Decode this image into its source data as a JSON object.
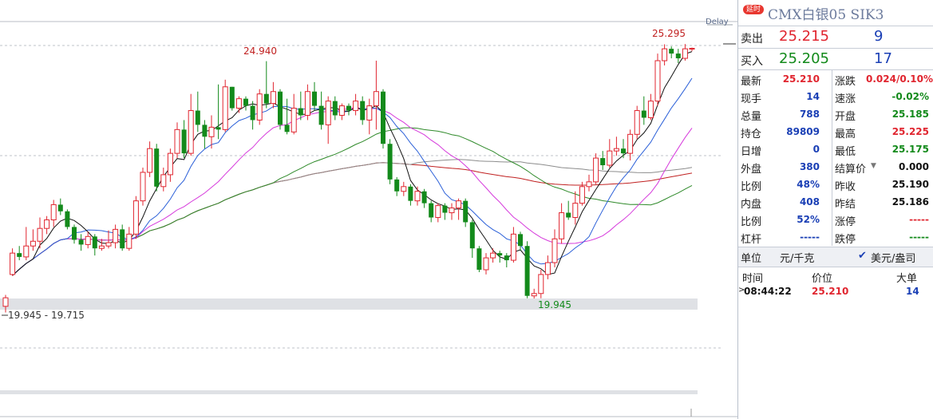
{
  "colors": {
    "up": "#e0252f",
    "down": "#138a1b",
    "ma5": "#111111",
    "ma10": "#2a5fd8",
    "ma20": "#d63adc",
    "ma40": "#2f8a2a",
    "ma60": "#8c8c8c",
    "ma120": "#c02020",
    "price_blue": "#1a3fb5"
  },
  "chart": {
    "delay_label": "Delay",
    "range_label": "19.945 - 19.715",
    "high_label": "24.940",
    "low_label": "19.945",
    "last_high_label": "25.295"
  },
  "chart_data": {
    "type": "candlestick",
    "ylim": [
      19.4,
      25.6
    ],
    "high_annotations": [
      24.94,
      25.295
    ],
    "low_annotation": 19.945,
    "candles": [
      [
        19.78,
        19.96,
        19.65,
        20.02
      ],
      [
        20.45,
        20.9,
        20.42,
        21.0
      ],
      [
        20.9,
        20.82,
        20.75,
        21.05
      ],
      [
        20.82,
        21.05,
        20.75,
        21.45
      ],
      [
        21.05,
        21.15,
        20.95,
        21.4
      ],
      [
        21.15,
        21.42,
        21.0,
        21.65
      ],
      [
        21.42,
        21.6,
        21.3,
        21.68
      ],
      [
        21.6,
        21.92,
        21.45,
        22.02
      ],
      [
        21.92,
        21.78,
        21.7,
        22.05
      ],
      [
        21.78,
        21.45,
        21.4,
        21.82
      ],
      [
        21.45,
        21.18,
        21.1,
        21.5
      ],
      [
        21.18,
        21.08,
        20.95,
        21.3
      ],
      [
        21.08,
        21.25,
        21.0,
        21.35
      ],
      [
        21.25,
        21.0,
        20.85,
        21.3
      ],
      [
        21.0,
        21.05,
        20.95,
        21.2
      ],
      [
        21.05,
        21.12,
        21.0,
        21.38
      ],
      [
        21.12,
        21.4,
        21.0,
        21.5
      ],
      [
        21.4,
        21.0,
        20.95,
        21.5
      ],
      [
        21.0,
        21.3,
        20.95,
        21.45
      ],
      [
        21.3,
        22.0,
        21.2,
        22.1
      ],
      [
        22.0,
        22.6,
        21.9,
        22.7
      ],
      [
        22.6,
        23.1,
        22.5,
        23.25
      ],
      [
        23.1,
        22.3,
        22.2,
        23.2
      ],
      [
        22.3,
        22.55,
        22.2,
        22.7
      ],
      [
        22.55,
        23.0,
        22.4,
        23.1
      ],
      [
        23.0,
        23.5,
        22.9,
        23.65
      ],
      [
        23.5,
        23.0,
        22.9,
        23.7
      ],
      [
        23.0,
        23.9,
        22.95,
        24.25
      ],
      [
        23.9,
        23.6,
        23.45,
        24.3
      ],
      [
        23.6,
        23.35,
        23.1,
        23.7
      ],
      [
        23.35,
        23.55,
        23.1,
        23.8
      ],
      [
        23.55,
        23.5,
        23.3,
        24.45
      ],
      [
        23.5,
        24.4,
        23.45,
        24.55
      ],
      [
        24.4,
        23.95,
        23.9,
        24.4
      ],
      [
        23.95,
        24.15,
        23.85,
        24.2
      ],
      [
        24.15,
        24.0,
        23.9,
        24.2
      ],
      [
        24.0,
        23.7,
        23.5,
        24.1
      ],
      [
        23.7,
        24.25,
        23.6,
        24.35
      ],
      [
        24.25,
        24.05,
        23.95,
        24.94
      ],
      [
        24.05,
        24.3,
        23.95,
        24.5
      ],
      [
        24.3,
        23.6,
        23.5,
        24.35
      ],
      [
        23.6,
        23.45,
        23.4,
        24.15
      ],
      [
        23.45,
        23.95,
        23.4,
        24.25
      ],
      [
        23.95,
        23.8,
        23.7,
        24.3
      ],
      [
        23.8,
        24.3,
        23.7,
        24.45
      ],
      [
        24.3,
        24.0,
        23.9,
        24.5
      ],
      [
        24.0,
        23.6,
        23.5,
        24.3
      ],
      [
        23.6,
        24.1,
        23.2,
        24.2
      ],
      [
        24.1,
        23.8,
        23.7,
        24.2
      ],
      [
        23.8,
        24.0,
        23.7,
        24.05
      ],
      [
        24.0,
        23.9,
        23.8,
        24.05
      ],
      [
        23.9,
        24.1,
        23.8,
        24.25
      ],
      [
        24.1,
        23.7,
        23.6,
        24.2
      ],
      [
        23.7,
        24.0,
        23.4,
        24.15
      ],
      [
        24.0,
        24.3,
        23.5,
        24.95
      ],
      [
        24.3,
        23.2,
        23.1,
        24.35
      ],
      [
        23.2,
        22.45,
        22.35,
        23.3
      ],
      [
        22.45,
        22.2,
        22.1,
        22.5
      ],
      [
        22.2,
        22.3,
        22.1,
        22.4
      ],
      [
        22.3,
        22.0,
        21.9,
        22.35
      ],
      [
        22.0,
        22.2,
        21.9,
        22.3
      ],
      [
        22.2,
        21.95,
        21.85,
        22.25
      ],
      [
        21.95,
        21.65,
        21.55,
        22.0
      ],
      [
        21.65,
        21.9,
        21.55,
        21.95
      ],
      [
        21.9,
        21.75,
        21.6,
        21.95
      ],
      [
        21.75,
        21.85,
        21.6,
        21.95
      ],
      [
        21.85,
        22.0,
        21.6,
        22.05
      ],
      [
        22.0,
        21.55,
        21.45,
        22.05
      ],
      [
        21.55,
        21.0,
        20.8,
        21.6
      ],
      [
        21.0,
        20.55,
        20.5,
        21.05
      ],
      [
        20.55,
        20.8,
        20.45,
        20.9
      ],
      [
        20.8,
        20.9,
        20.7,
        21.0
      ],
      [
        20.9,
        20.85,
        20.7,
        20.95
      ],
      [
        20.85,
        20.75,
        20.6,
        20.9
      ],
      [
        20.75,
        21.3,
        20.7,
        21.45
      ],
      [
        21.3,
        21.05,
        20.95,
        21.35
      ],
      [
        21.05,
        20.0,
        19.95,
        21.15
      ],
      [
        20.0,
        20.05,
        19.945,
        20.15
      ],
      [
        20.05,
        20.45,
        19.95,
        20.55
      ],
      [
        20.45,
        20.7,
        20.35,
        20.85
      ],
      [
        20.7,
        21.2,
        20.6,
        21.4
      ],
      [
        21.2,
        21.75,
        21.1,
        21.95
      ],
      [
        21.75,
        21.65,
        21.6,
        22.0
      ],
      [
        21.65,
        21.95,
        21.5,
        22.2
      ],
      [
        21.95,
        22.3,
        21.9,
        22.4
      ],
      [
        22.3,
        22.4,
        22.2,
        22.55
      ],
      [
        22.4,
        22.9,
        22.35,
        23.0
      ],
      [
        22.9,
        22.75,
        22.65,
        23.05
      ],
      [
        22.75,
        23.05,
        22.7,
        23.3
      ],
      [
        23.05,
        23.1,
        22.95,
        23.35
      ],
      [
        23.1,
        23.0,
        22.9,
        23.3
      ],
      [
        23.0,
        23.4,
        22.85,
        23.5
      ],
      [
        23.4,
        23.9,
        23.3,
        24.0
      ],
      [
        23.9,
        23.75,
        23.6,
        24.2
      ],
      [
        23.75,
        24.1,
        23.7,
        24.25
      ],
      [
        24.1,
        24.95,
        24.0,
        25.1
      ],
      [
        24.95,
        25.2,
        24.85,
        25.295
      ],
      [
        25.2,
        25.1,
        25.0,
        25.25
      ],
      [
        25.1,
        25.0,
        24.9,
        25.2
      ],
      [
        25.0,
        25.2,
        24.95,
        25.3
      ],
      [
        25.2,
        25.21,
        25.15,
        25.225
      ]
    ]
  },
  "panel": {
    "tag": "延时",
    "symbol": "CMX白银05  SIK3",
    "ask_label": "卖出",
    "ask_price": "25.215",
    "ask_vol": "9",
    "bid_label": "买入",
    "bid_price": "25.205",
    "bid_vol": "17",
    "left_rows": [
      {
        "label": "最新",
        "value": "25.210",
        "color": "#e0252f"
      },
      {
        "label": "现手",
        "value": "14",
        "color": "#1a3fb5"
      },
      {
        "label": "总量",
        "value": "788",
        "color": "#1a3fb5"
      },
      {
        "label": "持仓",
        "value": "89809",
        "color": "#1a3fb5"
      },
      {
        "label": "日增",
        "value": "0",
        "color": "#1a3fb5"
      },
      {
        "label": "外盘",
        "value": "380",
        "color": "#1a3fb5"
      },
      {
        "label": "比例",
        "value": "48%",
        "color": "#1a3fb5"
      },
      {
        "label": "内盘",
        "value": "408",
        "color": "#1a3fb5"
      },
      {
        "label": "比例",
        "value": "52%",
        "color": "#1a3fb5"
      },
      {
        "label": "杠杆",
        "value": "-----",
        "color": "#1a3fb5"
      }
    ],
    "right_rows": [
      {
        "label": "涨跌",
        "value": "0.024/0.10%",
        "color": "#e0252f"
      },
      {
        "label": "速涨",
        "value": "-0.02%",
        "color": "#138a1b"
      },
      {
        "label": "开盘",
        "value": "25.185",
        "color": "#138a1b"
      },
      {
        "label": "最高",
        "value": "25.225",
        "color": "#e0252f"
      },
      {
        "label": "最低",
        "value": "25.175",
        "color": "#138a1b"
      },
      {
        "label": "结算价",
        "value": "0.000",
        "color": "#111111"
      },
      {
        "label": "昨收",
        "value": "25.190",
        "color": "#111111"
      },
      {
        "label": "昨结",
        "value": "25.186",
        "color": "#111111"
      },
      {
        "label": "涨停",
        "value": "-----",
        "color": "#e0252f"
      },
      {
        "label": "跌停",
        "value": "-----",
        "color": "#138a1b"
      }
    ],
    "unit_label": "单位",
    "unit_value": "元/千克",
    "currency_label": "美元/盎司",
    "ticks_header": {
      "time": "时间",
      "price": "价位",
      "vol": "大单"
    },
    "tick": {
      "time": "08:44:22",
      "price": "25.210",
      "vol": "14"
    }
  }
}
